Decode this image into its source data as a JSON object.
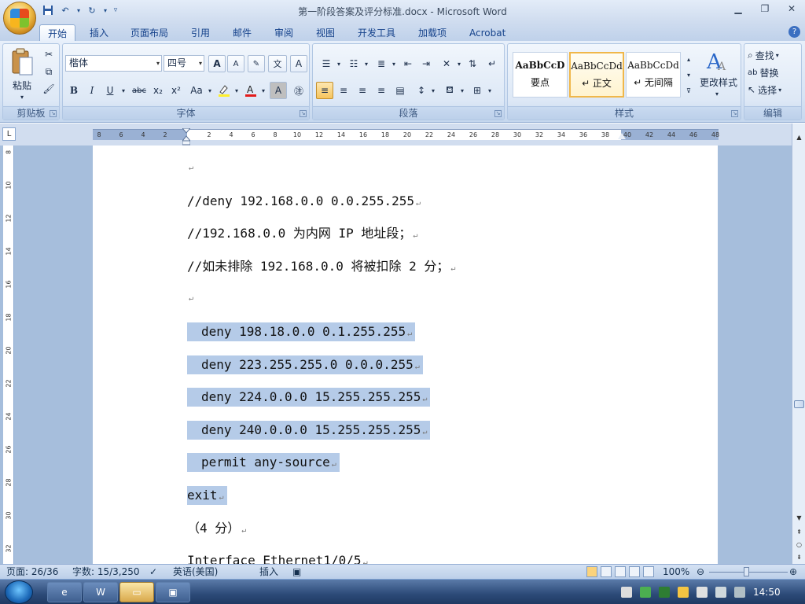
{
  "app": {
    "title": "第一阶段答案及评分标准.docx - Microsoft Word"
  },
  "tabs": [
    "开始",
    "插入",
    "页面布局",
    "引用",
    "邮件",
    "审阅",
    "视图",
    "开发工具",
    "加载项",
    "Acrobat"
  ],
  "ribbon": {
    "clipboard": {
      "label": "剪贴板",
      "paste": "粘贴"
    },
    "font": {
      "label": "字体",
      "font_name": "楷体",
      "font_size": "四号",
      "bold": "B",
      "italic": "I",
      "underline": "U",
      "strike": "abc",
      "subscript": "x₂",
      "superscript": "x²",
      "change_case": "Aa",
      "grow": "A",
      "shrink": "A",
      "char_border": "A",
      "char_shading": "A",
      "phonetic": "文"
    },
    "paragraph": {
      "label": "段落"
    },
    "styles": {
      "label": "样式",
      "items": [
        {
          "sample": "AaBbCcD",
          "name": "要点"
        },
        {
          "sample": "AaBbCcDd",
          "name": "↵ 正文"
        },
        {
          "sample": "AaBbCcDd",
          "name": "↵ 无间隔"
        }
      ],
      "change_styles": "更改样式"
    },
    "editing": {
      "label": "编辑",
      "find": "查找",
      "replace": "替换",
      "select": "选择"
    }
  },
  "ruler": {
    "h_ticks": [
      "8",
      "6",
      "4",
      "2",
      "2",
      "4",
      "6",
      "8",
      "10",
      "12",
      "14",
      "16",
      "18",
      "20",
      "22",
      "24",
      "26",
      "28",
      "30",
      "32",
      "34",
      "36",
      "38",
      "40",
      "42",
      "44",
      "46",
      "48"
    ],
    "v_ticks": [
      "8",
      "10",
      "12",
      "14",
      "16",
      "18",
      "20",
      "22",
      "24",
      "26",
      "28",
      "30",
      "32"
    ]
  },
  "document": {
    "pmark": "↵",
    "lines": [
      "",
      "//deny 192.168.0.0 0.0.255.255",
      "//192.168.0.0 为内网 IP 地址段；",
      "//如未排除 192.168.0.0 将被扣除 2 分；",
      "",
      "deny 198.18.0.0 0.1.255.255",
      "deny 223.255.255.0 0.0.0.255",
      "deny 224.0.0.0 15.255.255.255",
      "deny 240.0.0.0 15.255.255.255",
      "permit any-source",
      "exit",
      "（4 分）",
      "Interface Ethernet1/0/5"
    ]
  },
  "statusbar": {
    "page": "页面: 26/36",
    "words": "字数: 15/3,250",
    "language": "英语(美国)",
    "mode": "插入",
    "zoom": "100%"
  },
  "taskbar": {
    "clock": "14:50"
  }
}
